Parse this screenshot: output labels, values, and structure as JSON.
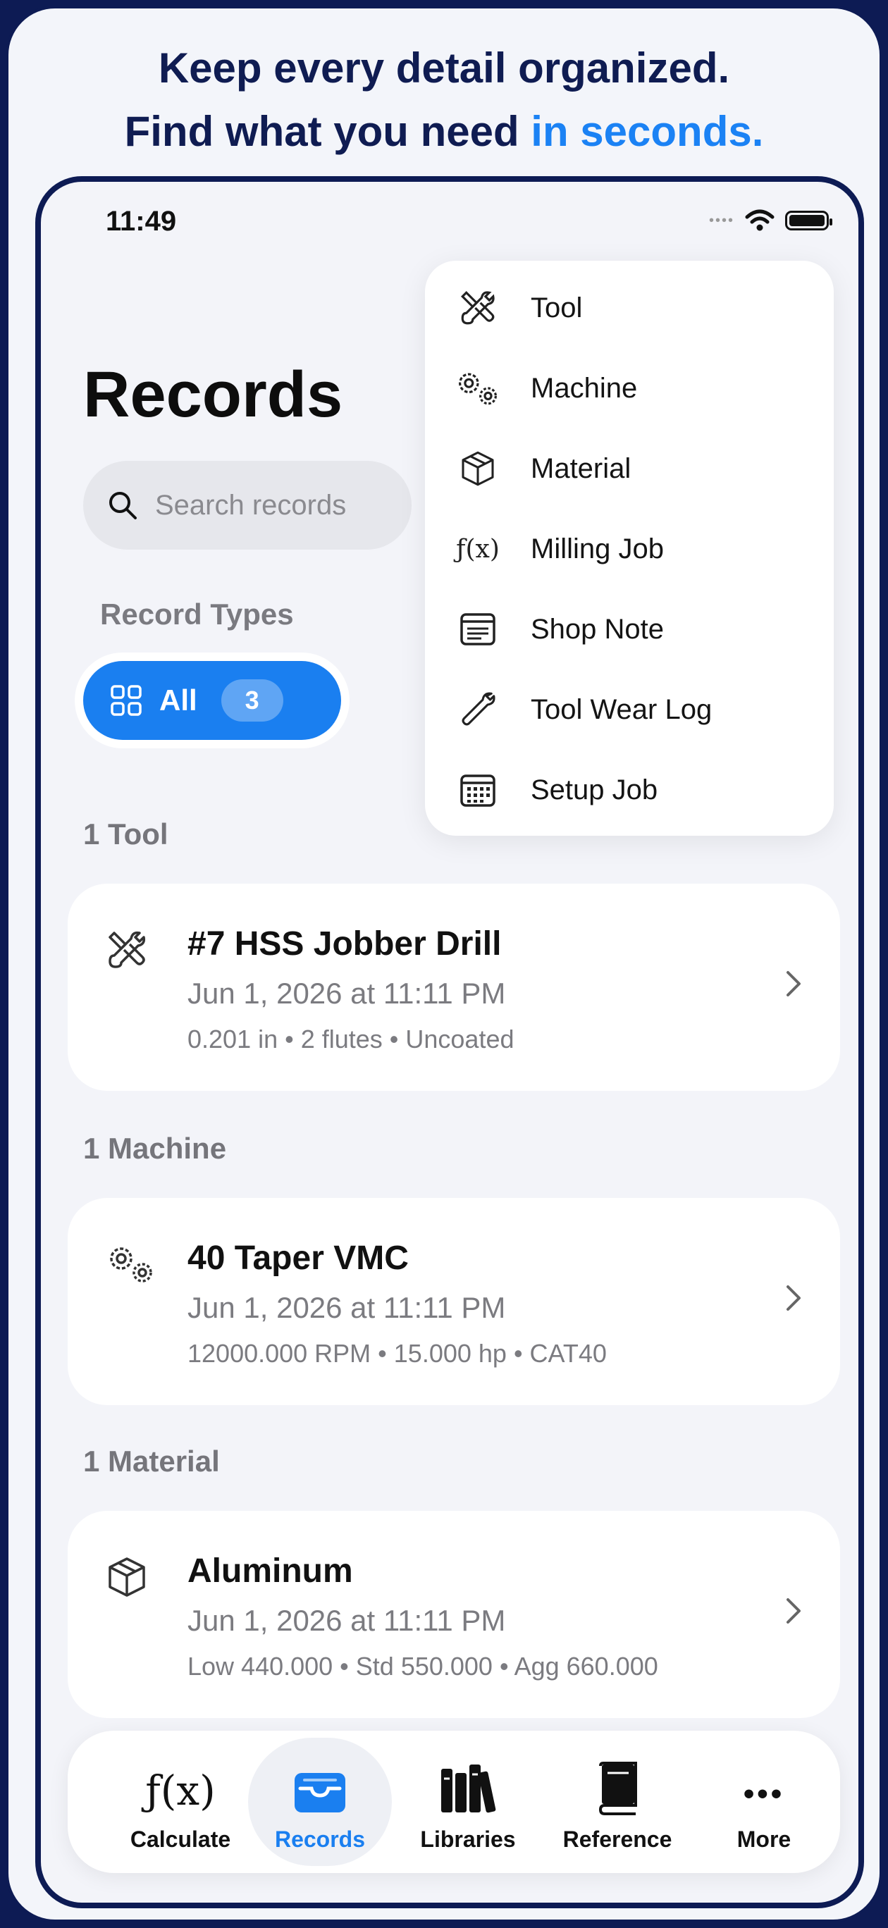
{
  "headline": {
    "line1": "Keep every detail organized.",
    "line2_prefix": "Find what you need ",
    "line2_accent": "in seconds."
  },
  "status": {
    "time": "11:49",
    "signal": "••••"
  },
  "page": {
    "title": "Records"
  },
  "search": {
    "placeholder": "Search records"
  },
  "record_types": {
    "label": "Record Types",
    "chip": {
      "label": "All",
      "count": "3"
    }
  },
  "menu": {
    "items": [
      {
        "label": "Tool",
        "icon": "tool-icon"
      },
      {
        "label": "Machine",
        "icon": "gears-icon"
      },
      {
        "label": "Material",
        "icon": "cube-icon"
      },
      {
        "label": "Milling Job",
        "icon": "function-icon",
        "glyph": "ƒ(x)"
      },
      {
        "label": "Shop Note",
        "icon": "note-icon"
      },
      {
        "label": "Tool Wear Log",
        "icon": "wrench-icon"
      },
      {
        "label": "Setup Job",
        "icon": "calendar-icon"
      }
    ]
  },
  "sections": [
    {
      "heading": "1 Tool",
      "record": {
        "name": "#7 HSS Jobber Drill",
        "date": "Jun 1, 2026 at 11:11 PM",
        "meta": "0.201 in • 2 flutes • Uncoated",
        "icon": "tool-icon"
      }
    },
    {
      "heading": "1 Machine",
      "record": {
        "name": "40 Taper VMC",
        "date": "Jun 1, 2026 at 11:11 PM",
        "meta": "12000.000 RPM • 15.000 hp • CAT40",
        "icon": "gears-icon"
      }
    },
    {
      "heading": "1 Material",
      "record": {
        "name": "Aluminum",
        "date": "Jun 1, 2026 at 11:11 PM",
        "meta": "Low 440.000 • Std 550.000 • Agg 660.000",
        "icon": "cube-icon"
      }
    }
  ],
  "tabbar": {
    "tabs": [
      {
        "label": "Calculate",
        "icon": "function-icon",
        "glyph": "ƒ(x)"
      },
      {
        "label": "Records",
        "icon": "tray-icon",
        "active": true
      },
      {
        "label": "Libraries",
        "icon": "books-icon"
      },
      {
        "label": "Reference",
        "icon": "book-icon"
      },
      {
        "label": "More",
        "icon": "ellipsis-icon",
        "glyph": "•••"
      }
    ]
  },
  "colors": {
    "accent": "#1a7ff0",
    "navy": "#0d1b54",
    "background": "#f3f4f9"
  }
}
